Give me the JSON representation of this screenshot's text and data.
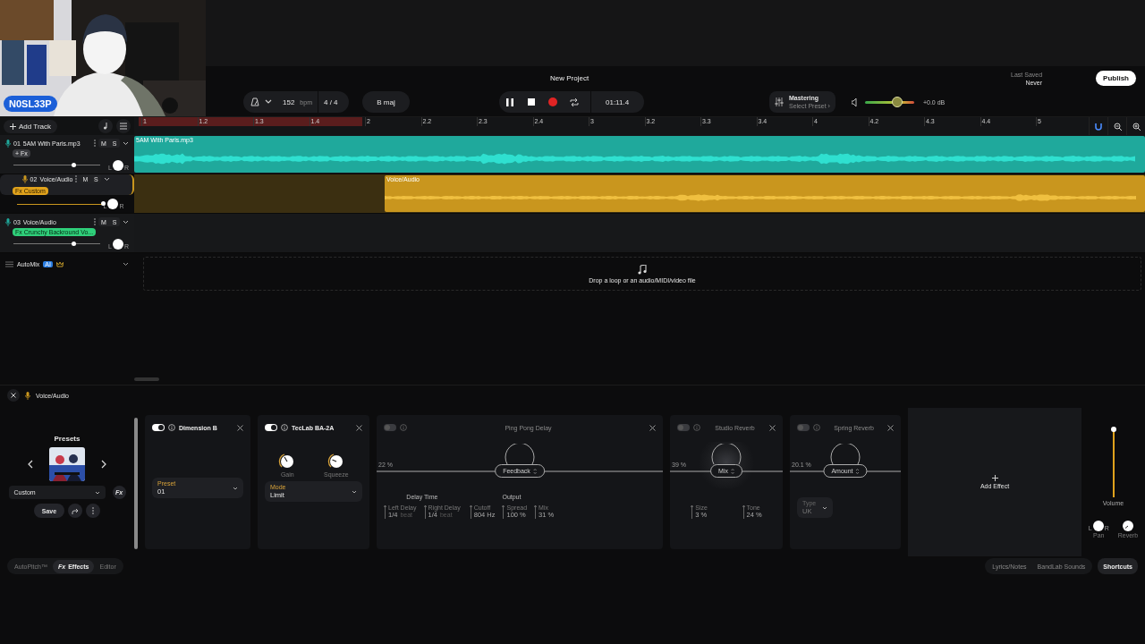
{
  "webcam": {
    "name_tag": "N0SL33P"
  },
  "header": {
    "title": "New Project",
    "save_status": {
      "label": "Last Saved",
      "value": "Never"
    },
    "publish": "Publish"
  },
  "toolbar": {
    "tempo": "152",
    "tempo_unit": "bpm",
    "time_signature": "4 / 4",
    "key": "B maj",
    "time": "01:11.4",
    "mastering": {
      "title": "Mastering",
      "subtitle": "Select Preset ›"
    },
    "master_volume": {
      "level": 0.65,
      "reading": "+0.0 dB"
    }
  },
  "track_panel": {
    "add_track": "Add Track"
  },
  "ruler": {
    "labels": [
      "1",
      "1.2",
      "1.3",
      "1.4",
      "2",
      "2.2",
      "2.3",
      "2.4",
      "3",
      "3.2",
      "3.3",
      "3.4",
      "4",
      "4.2",
      "4.3",
      "4.4",
      "5"
    ]
  },
  "tracks": [
    {
      "number": "01",
      "name": "5AM With Paris.mp3",
      "mute": "M",
      "solo": "S",
      "fx": {
        "kind": "add",
        "label": "+ Fx"
      },
      "color": "#1fa99c",
      "selected": false,
      "level": 0.7,
      "pan": {
        "left": "L",
        "right": "R"
      },
      "clip": {
        "name": "5AM With Paris.mp3",
        "after_loop": false
      }
    },
    {
      "number": "02",
      "name": "Voice/Audio",
      "mute": "M",
      "solo": "S",
      "fx": {
        "kind": "custom",
        "label": "Fx Custom"
      },
      "color": "#c9961e",
      "selected": true,
      "level": 1,
      "pan": {
        "left": "L",
        "right": "R"
      },
      "clip": {
        "name": "Voice/Audio",
        "after_loop": true
      }
    },
    {
      "number": "03",
      "name": "Voice/Audio",
      "mute": "M",
      "solo": "S",
      "fx": {
        "kind": "preset",
        "label": "Fx Crunchy Backround Vo..."
      },
      "color": "#1fa99c",
      "selected": false,
      "level": 0.7,
      "pan": {
        "left": "L",
        "right": "R"
      }
    }
  ],
  "automix": {
    "label": "AutoMix",
    "badge": "AI"
  },
  "drop_zone": {
    "text": "Drop a loop or an audio/MIDI/video file"
  },
  "editor": {
    "track_name": "Voice/Audio",
    "presets": {
      "title": "Presets",
      "value": "Custom",
      "fx_button": "Fx",
      "save": "Save"
    },
    "effects": [
      {
        "kind": "preset",
        "name": "Dimension B",
        "on": true,
        "select": {
          "label": "Preset",
          "value": "01"
        }
      },
      {
        "kind": "knobs",
        "name": "TecLab BA-2A",
        "on": true,
        "knobs": [
          {
            "label": "Gain"
          },
          {
            "label": "Squeeze"
          }
        ],
        "select": {
          "label": "Mode",
          "value": "Limit"
        }
      },
      {
        "kind": "delay",
        "name": "Ping Pong Delay",
        "on": false,
        "dial": {
          "label": "Feedback",
          "reading": "22 %"
        },
        "groups": [
          {
            "label": "Delay Time",
            "params": [
              {
                "label": "Left Delay",
                "value": "1/4",
                "unit": "beat"
              },
              {
                "label": "Right Delay",
                "value": "1/4",
                "unit": "beat"
              }
            ]
          },
          {
            "label": "Output",
            "params": [
              {
                "label": "Cutoff",
                "value": "804 Hz"
              },
              {
                "label": "Spread",
                "value": "100 %"
              },
              {
                "label": "Mix",
                "value": "31 %"
              }
            ]
          }
        ]
      },
      {
        "kind": "reverb",
        "name": "Studio Reverb",
        "on": false,
        "dial": {
          "label": "Mix",
          "reading": "39 %"
        },
        "params": [
          {
            "label": "Size",
            "value": "3 %"
          },
          {
            "label": "Tone",
            "value": "24 %"
          }
        ]
      },
      {
        "kind": "spring",
        "name": "Spring Reverb",
        "on": false,
        "dial": {
          "label": "Amount",
          "reading": "20.1 %"
        },
        "select": {
          "label": "Type",
          "value": "UK"
        }
      }
    ],
    "add_effect": "Add Effect",
    "mixer": {
      "volume": {
        "label": "Volume",
        "level": 1
      },
      "pan": {
        "label": "Pan",
        "left": "L",
        "right": "R"
      },
      "reverb": {
        "label": "Reverb"
      }
    }
  },
  "bottom_tabs": [
    {
      "label": "AutoPitch™",
      "selected": false
    },
    {
      "label": "Effects",
      "glyph": "Fx",
      "selected": true
    },
    {
      "label": "Editor",
      "selected": false
    }
  ],
  "bottom_tools": [
    {
      "label": "Lyrics/Notes"
    },
    {
      "label": "BandLab Sounds"
    },
    {
      "label": "Shortcuts"
    }
  ]
}
